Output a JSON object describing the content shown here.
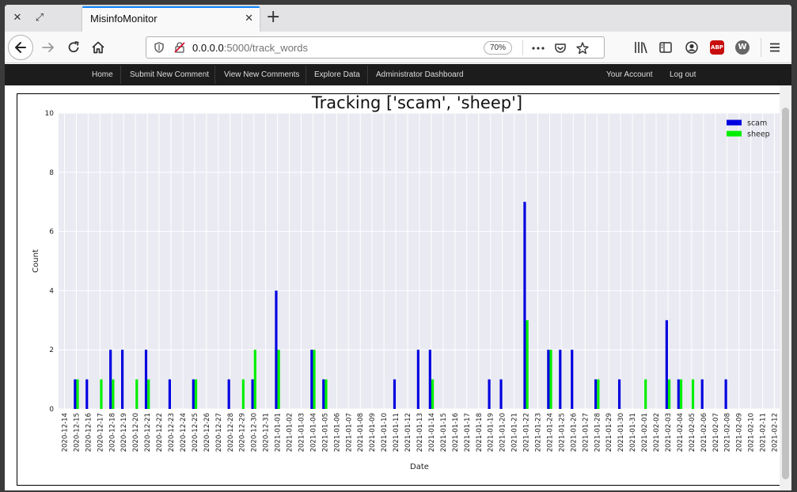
{
  "browser": {
    "tab_title": "MisinfoMonitor",
    "url_host": "0.0.0.0",
    "url_path": ":5000/track_words",
    "zoom": "70%",
    "abp_label": "ABP",
    "w_label": "W"
  },
  "site_nav": {
    "left": [
      "Home",
      "Submit New Comment",
      "View New Comments",
      "Explore Data",
      "Administrator Dashboard"
    ],
    "right": [
      "Your Account",
      "Log out"
    ]
  },
  "colors": {
    "scam": "#0000e0",
    "sheep": "#00ee00",
    "plot_bg": "#eaeaf2",
    "grid": "#ffffff",
    "site_nav_bg": "#1c1c1c"
  },
  "chart_data": {
    "type": "bar",
    "title": "Tracking ['scam', 'sheep']",
    "xlabel": "Date",
    "ylabel": "Count",
    "ylim": [
      0,
      10
    ],
    "yticks": [
      0,
      2,
      4,
      6,
      8,
      10
    ],
    "grid": true,
    "legend_position": "top-right",
    "categories": [
      "2020-12-14",
      "2020-12-15",
      "2020-12-16",
      "2020-12-17",
      "2020-12-18",
      "2020-12-19",
      "2020-12-20",
      "2020-12-21",
      "2020-12-22",
      "2020-12-23",
      "2020-12-24",
      "2020-12-25",
      "2020-12-26",
      "2020-12-27",
      "2020-12-28",
      "2020-12-29",
      "2020-12-30",
      "2020-12-31",
      "2021-01-01",
      "2021-01-02",
      "2021-01-03",
      "2021-01-04",
      "2021-01-05",
      "2021-01-06",
      "2021-01-07",
      "2021-01-08",
      "2021-01-09",
      "2021-01-10",
      "2021-01-11",
      "2021-01-12",
      "2021-01-13",
      "2021-01-14",
      "2021-01-15",
      "2021-01-16",
      "2021-01-17",
      "2021-01-18",
      "2021-01-19",
      "2021-01-20",
      "2021-01-21",
      "2021-01-22",
      "2021-01-23",
      "2021-01-24",
      "2021-01-25",
      "2021-01-26",
      "2021-01-27",
      "2021-01-28",
      "2021-01-29",
      "2021-01-30",
      "2021-01-31",
      "2021-02-01",
      "2021-02-02",
      "2021-02-03",
      "2021-02-04",
      "2021-02-05",
      "2021-02-06",
      "2021-02-07",
      "2021-02-08",
      "2021-02-09",
      "2021-02-10",
      "2021-02-11",
      "2021-02-12"
    ],
    "series": [
      {
        "name": "scam",
        "color": "#0000e0",
        "values": [
          0,
          1,
          1,
          0,
          2,
          2,
          0,
          2,
          0,
          1,
          0,
          1,
          0,
          0,
          1,
          0,
          1,
          0,
          4,
          0,
          0,
          2,
          1,
          0,
          0,
          0,
          0,
          0,
          1,
          0,
          2,
          2,
          0,
          0,
          0,
          0,
          1,
          1,
          0,
          7,
          0,
          2,
          2,
          2,
          0,
          1,
          0,
          1,
          0,
          0,
          0,
          3,
          1,
          0,
          1,
          0,
          1,
          0,
          0,
          0,
          0
        ]
      },
      {
        "name": "sheep",
        "color": "#00ee00",
        "values": [
          0,
          1,
          0,
          1,
          1,
          0,
          1,
          1,
          0,
          0,
          0,
          1,
          0,
          0,
          0,
          1,
          2,
          0,
          2,
          0,
          0,
          2,
          1,
          0,
          0,
          0,
          0,
          0,
          0,
          0,
          0,
          1,
          0,
          0,
          0,
          0,
          0,
          0,
          0,
          3,
          0,
          2,
          0,
          0,
          0,
          1,
          0,
          0,
          0,
          1,
          0,
          1,
          1,
          1,
          0,
          0,
          0,
          0,
          0,
          0,
          0
        ]
      }
    ]
  }
}
